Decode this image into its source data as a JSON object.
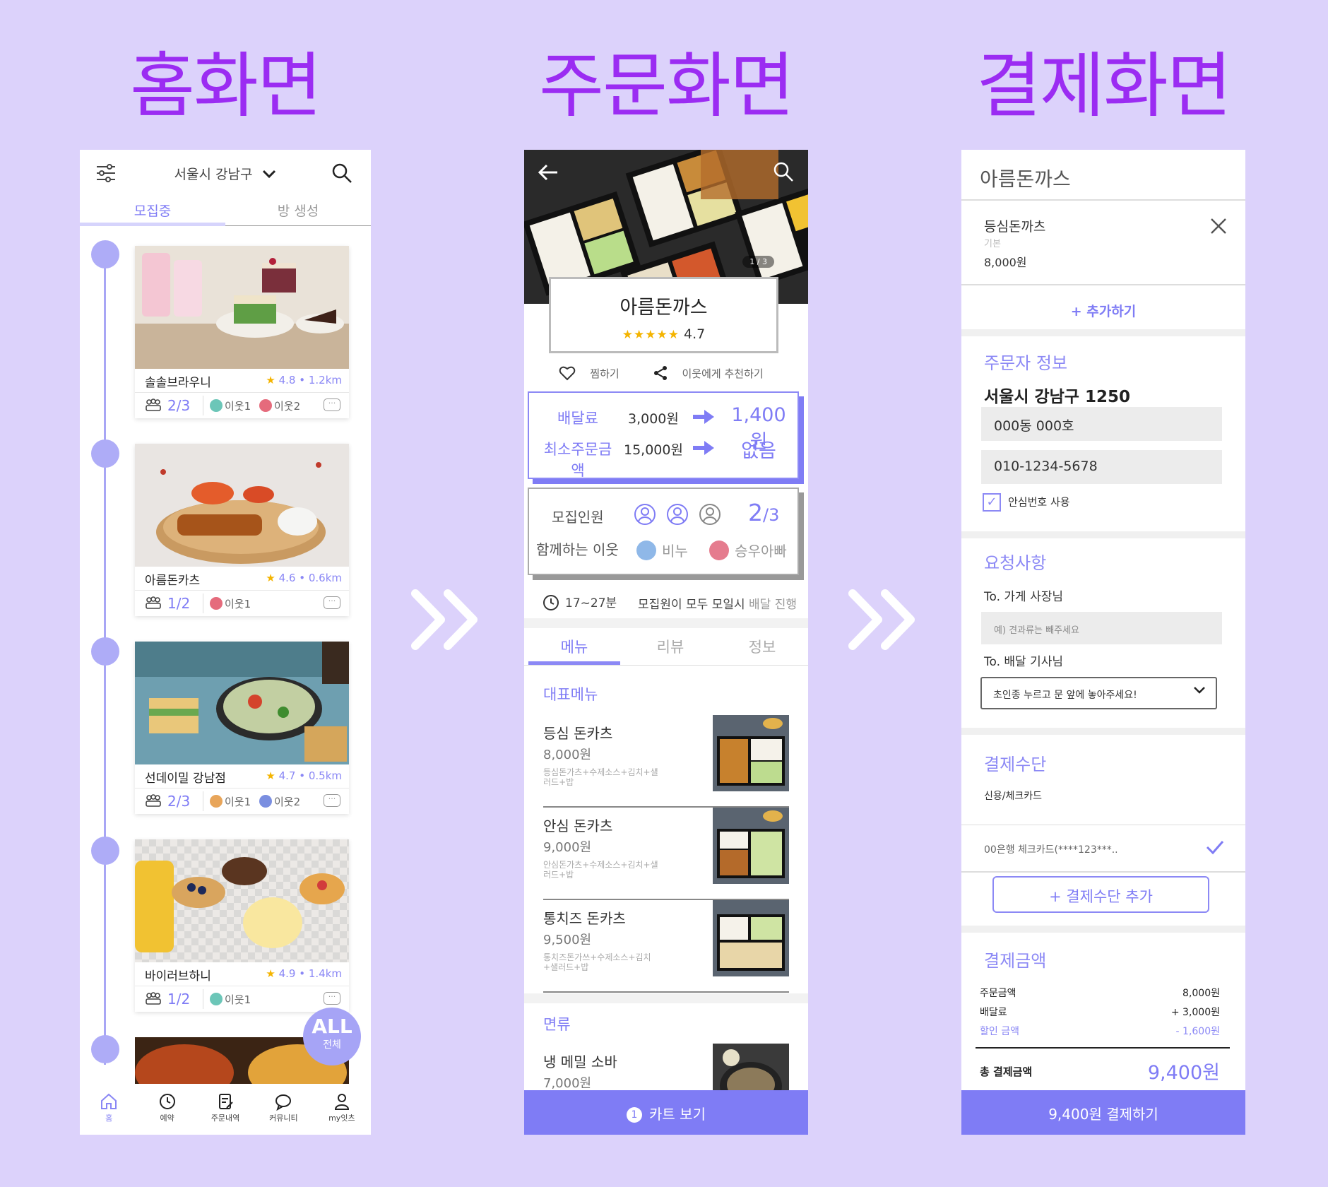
{
  "headings": {
    "home": "홈화면",
    "order": "주문화면",
    "pay": "결제화면"
  },
  "colors": {
    "background": "#dcd2fb",
    "heading": "#9b2cf2",
    "accent": "#7f7cf5",
    "accent_light": "#aeacf7",
    "star": "#f4b400"
  },
  "home": {
    "location": "서울시 강남구",
    "tabs": [
      "모집중",
      "방 생성"
    ],
    "active_tab": 0,
    "cards": [
      {
        "name": "솔솔브라우니",
        "rating": "4.8",
        "distance": "1.2km",
        "people": "2/3",
        "neighbors": [
          "이웃1",
          "이웃2"
        ]
      },
      {
        "name": "아름돈카츠",
        "rating": "4.6",
        "distance": "0.6km",
        "people": "1/2",
        "neighbors": [
          "이웃1"
        ]
      },
      {
        "name": "선데이밀 강남점",
        "rating": "4.7",
        "distance": "0.5km",
        "people": "2/3",
        "neighbors": [
          "이웃1",
          "이웃2"
        ]
      },
      {
        "name": "바이러브하니",
        "rating": "4.9",
        "distance": "1.4km",
        "people": "1/2",
        "neighbors": [
          "이웃1"
        ]
      }
    ],
    "all_button": {
      "main": "ALL",
      "sub": "전체"
    },
    "nav": [
      "홈",
      "예약",
      "주문내역",
      "커뮤니티",
      "my잇츠"
    ],
    "active_nav": 0
  },
  "order": {
    "photo_counter": "1 / 3",
    "shop_name": "아름돈까스",
    "rating": "4.7",
    "like_label": "찜하기",
    "share_label": "이웃에게 추천하기",
    "delivery_fee_label": "배달료",
    "delivery_fee_old": "3,000원",
    "delivery_fee_new": "1,400원",
    "min_order_label": "최소주문금액",
    "min_order_old": "15,000원",
    "min_order_new": "없음",
    "recruit_label": "모집인원",
    "recruit_count": "2",
    "recruit_total": "/3",
    "with_label": "함께하는 이웃",
    "neighbors": [
      "비누",
      "승우아빠"
    ],
    "time": "17~27분",
    "delivery_note": "모집원이 모두 모일시",
    "delivery_note_gray": "배달 진행",
    "tabs": [
      "메뉴",
      "리뷰",
      "정보"
    ],
    "section_main": "대표메뉴",
    "menu": [
      {
        "name": "등심 돈카츠",
        "price": "8,000원",
        "desc": "등심돈가츠+수제소스+김치+샐러드+밥"
      },
      {
        "name": "안심 돈카츠",
        "price": "9,000원",
        "desc": "안심돈가츠+수제소스+김치+샐러드+밥"
      },
      {
        "name": "통치즈 돈카츠",
        "price": "9,500원",
        "desc": "통치즈돈가쓰+수제소스+김치+샐러드+밥"
      }
    ],
    "section_noodle": "면류",
    "noodle_menu": {
      "name": "냉 메밀 소바",
      "price": "7,000원"
    },
    "cart_count": "1",
    "cart_label": "카트 보기"
  },
  "pay": {
    "shop_name": "아름돈까스",
    "item_name": "등심돈까츠",
    "item_option": "기본",
    "item_price": "8,000원",
    "add_more": "+ 추가하기",
    "orderer_title": "주문자 정보",
    "address": "서울시 강남구 1250",
    "address_detail": "000동 000호",
    "phone": "010-1234-5678",
    "safe_number": "안심번호 사용",
    "request_title": "요청사항",
    "to_store": "To. 가게 사장님",
    "to_store_placeholder": "예) 견과류는 빼주세요",
    "to_rider": "To. 배달 기사님",
    "rider_option": "초인종 누르고 문 앞에 놓아주세요!",
    "method_title": "결제수단",
    "method_type": "신용/체크카드",
    "card": "00은행 체크카드(****123***..",
    "add_method": "+ 결제수단 추가",
    "amount_title": "결제금액",
    "order_amount_label": "주문금액",
    "order_amount": "8,000원",
    "delivery_label": "배달료",
    "delivery_amount": "+ 3,000원",
    "discount_label": "할인 금액",
    "discount_amount": "- 1,600원",
    "total_label": "총 결제금액",
    "total_amount": "9,400원",
    "pay_button": "9,400원 결제하기"
  }
}
